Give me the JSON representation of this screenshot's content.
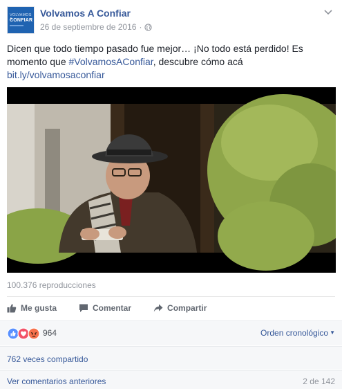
{
  "post": {
    "page_name": "Volvamos A Confiar",
    "date": "26 de septiembre de 2016",
    "separator": "·",
    "avatar": {
      "line1": "VOLVAMOS A",
      "line2": "CONFIAR"
    },
    "text_intro": "Dicen que todo tiempo pasado fue mejor… ¡No todo está perdido! Es momento que ",
    "hashtag": "#VolvamosAConfiar",
    "text_after": ", descubre cómo acá",
    "link": "bit.ly/volvamosaconfiar"
  },
  "video": {
    "views": "100.376 reproducciones"
  },
  "actions": {
    "like": "Me gusta",
    "comment": "Comentar",
    "share": "Compartir"
  },
  "reactions": {
    "count": "964",
    "order_label": "Orden cronológico",
    "caret": "▼",
    "types": [
      "like-icon",
      "love-icon",
      "angry-icon"
    ]
  },
  "shares": {
    "label": "762 veces compartido"
  },
  "comments": {
    "prev_label": "Ver comentarios anteriores",
    "pager": "2 de 142"
  },
  "colors": {
    "link": "#365899",
    "muted": "#90949c",
    "action": "#616770",
    "like_blue": "#5890ff",
    "love_red": "#f25268",
    "angry_orange": "#f7714c"
  }
}
